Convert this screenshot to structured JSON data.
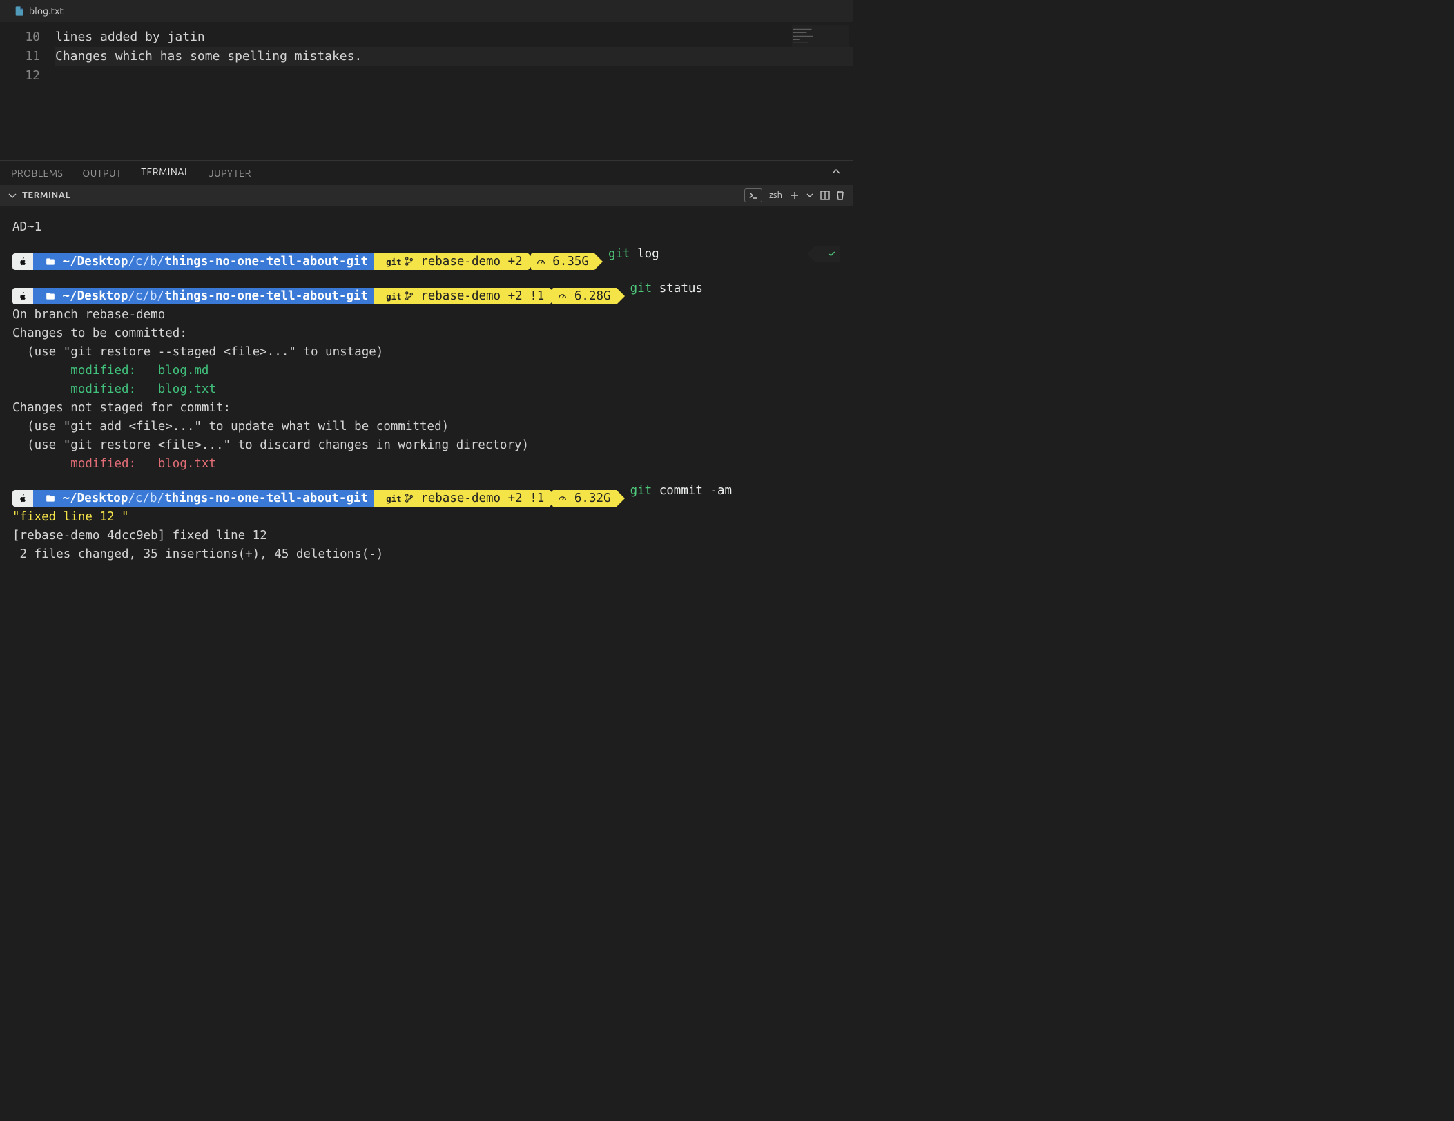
{
  "tab": {
    "filename": "blog.txt"
  },
  "editor": {
    "lines": [
      {
        "num": "10",
        "text": "lines added by jatin"
      },
      {
        "num": "11",
        "text": ""
      },
      {
        "num": "12",
        "text": "Changes which has some spelling mistakes."
      }
    ]
  },
  "panel": {
    "tabs": {
      "problems": "PROBLEMS",
      "output": "OUTPUT",
      "terminal": "TERMINAL",
      "jupyter": "JUPYTER"
    },
    "terminal_title": "TERMINAL",
    "shell": "zsh"
  },
  "term": {
    "head_line": "AD~1",
    "prompts": [
      {
        "path_prefix": "~/Desktop",
        "path_mid": "/c/b/",
        "path_repo": "things-no-one-tell-about-git",
        "git_label": "git",
        "branch": "rebase-demo +2",
        "disk": "6.35G",
        "cmd_git": "git",
        "cmd_rest": " log",
        "check": true
      },
      {
        "path_prefix": "~/Desktop",
        "path_mid": "/c/b/",
        "path_repo": "things-no-one-tell-about-git",
        "git_label": "git",
        "branch": "rebase-demo +2 !1",
        "disk": "6.28G",
        "cmd_git": "git",
        "cmd_rest": " status",
        "check": false
      },
      {
        "path_prefix": "~/Desktop",
        "path_mid": "/c/b/",
        "path_repo": "things-no-one-tell-about-git",
        "git_label": "git",
        "branch": "rebase-demo +2 !1",
        "disk": "6.32G",
        "cmd_git": "git",
        "cmd_rest": " commit -am",
        "check": false
      }
    ],
    "status_out": {
      "l1": "On branch rebase-demo",
      "l2": "Changes to be committed:",
      "l3": "  (use \"git restore --staged <file>...\" to unstage)",
      "l4": "        modified:   blog.md",
      "l5": "        modified:   blog.txt",
      "l6": "",
      "l7": "Changes not staged for commit:",
      "l8": "  (use \"git add <file>...\" to update what will be committed)",
      "l9": "  (use \"git restore <file>...\" to discard changes in working directory)",
      "l10": "        modified:   blog.txt"
    },
    "commit_out": {
      "l1": "\"fixed line 12 \"",
      "l2": "[rebase-demo 4dcc9eb] fixed line 12",
      "l3": " 2 files changed, 35 insertions(+), 45 deletions(-)"
    }
  }
}
